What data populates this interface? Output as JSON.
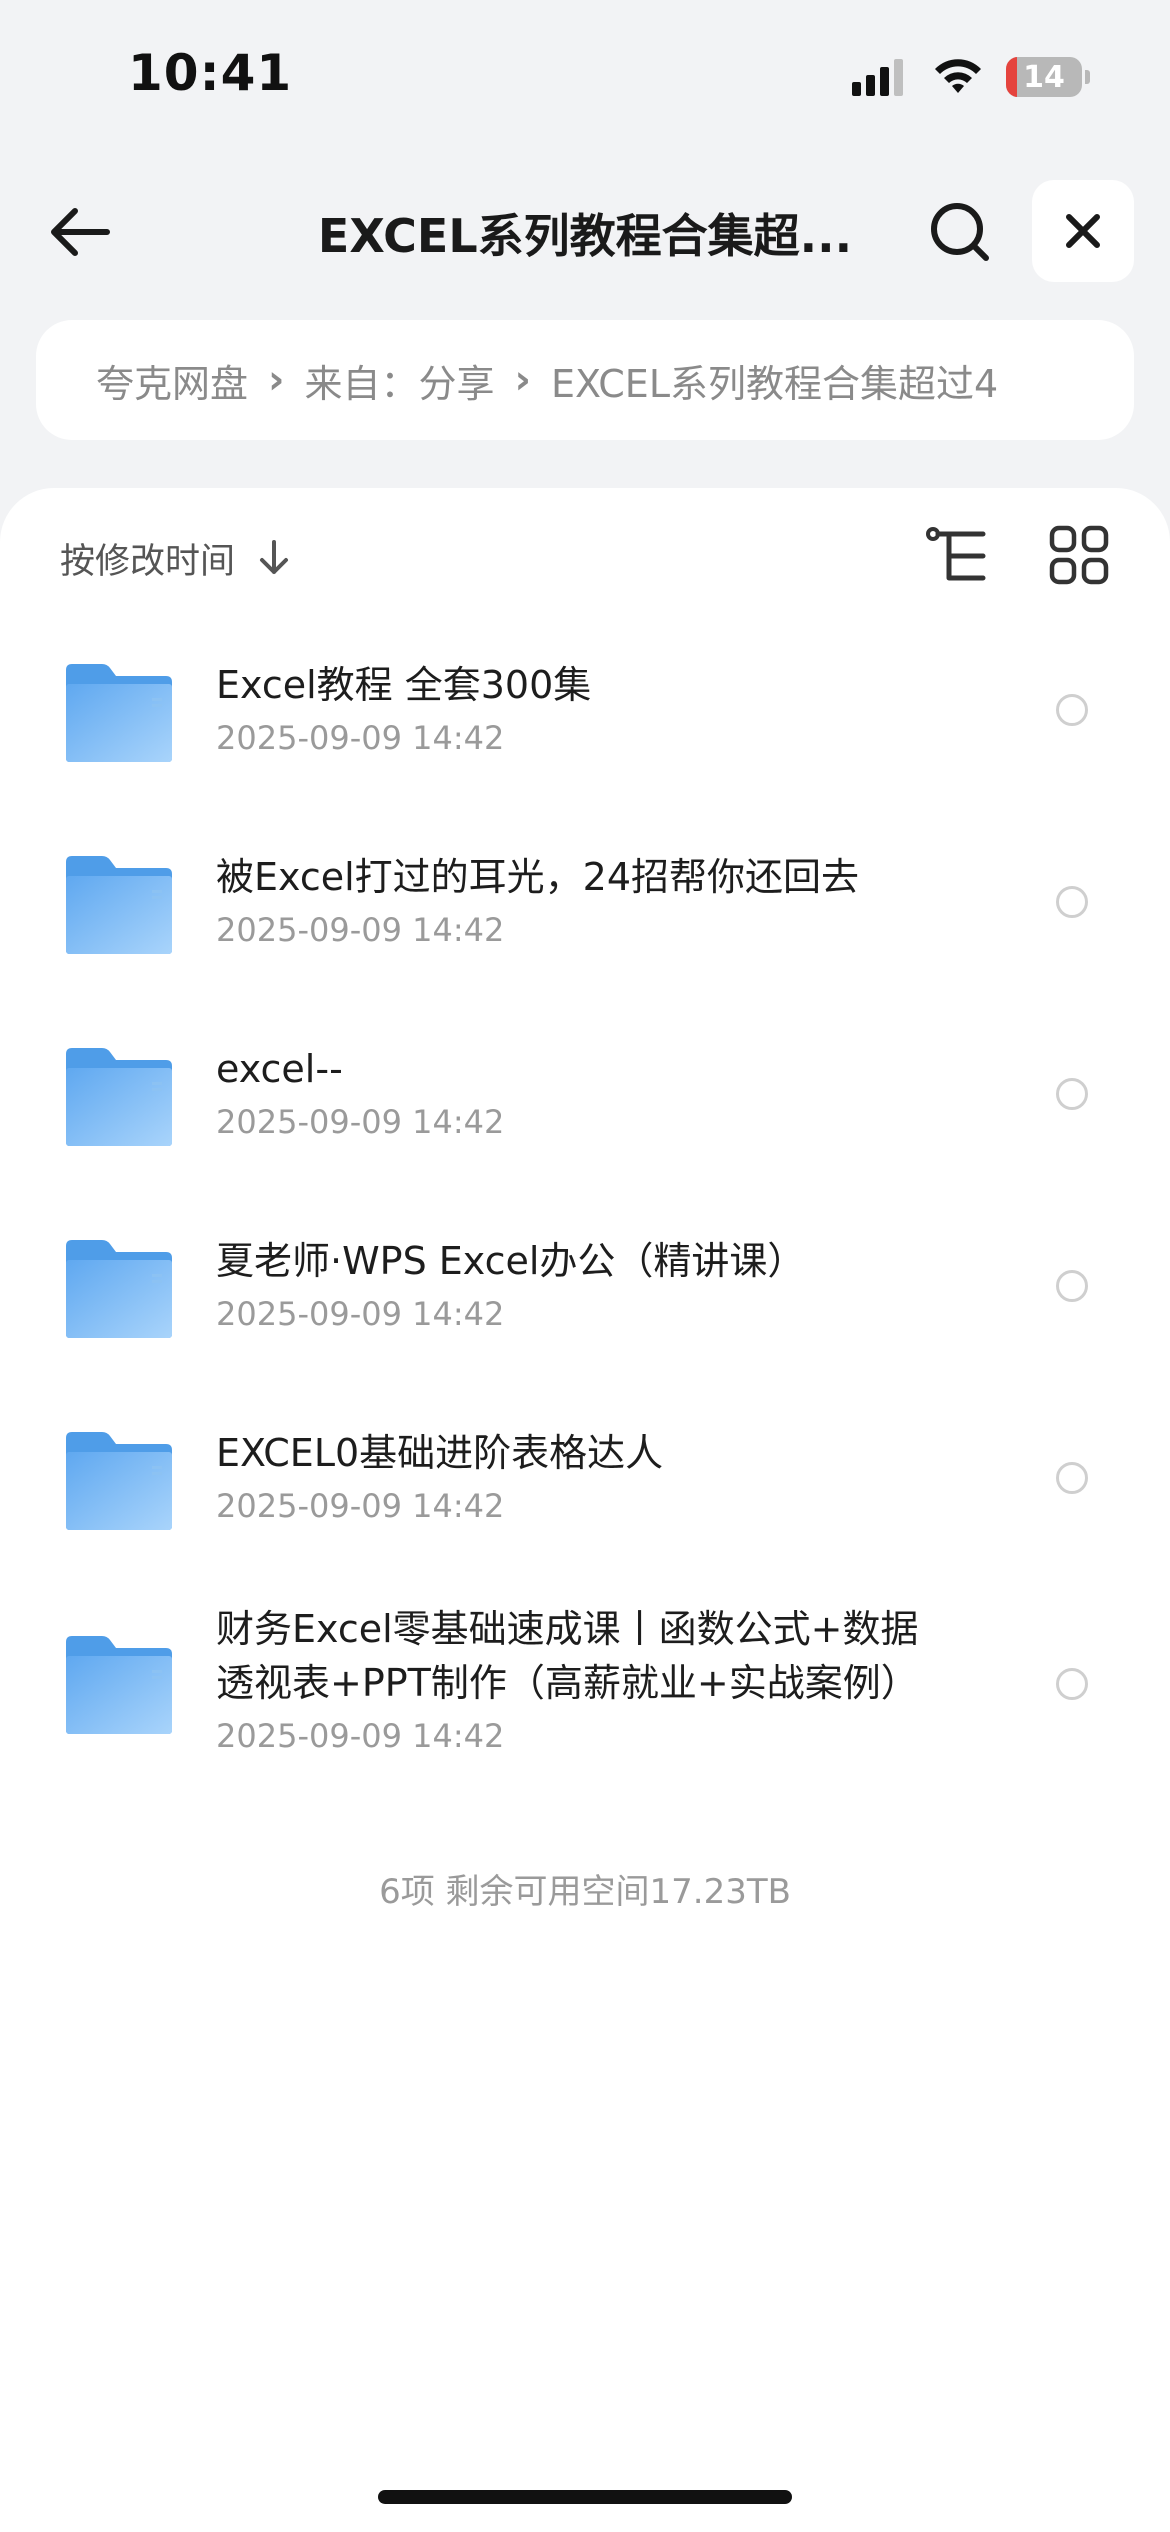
{
  "status_bar": {
    "time": "10:41",
    "battery_level": "14",
    "battery_fraction": 0.14,
    "signal_bars": 3,
    "signal_max": 4,
    "icons": [
      "signal-icon",
      "wifi-icon",
      "battery-icon"
    ]
  },
  "header": {
    "title": "EXCEL系列教程合集超...",
    "back_icon": "arrow-left-icon",
    "search_icon": "search-icon",
    "close_icon": "close-icon"
  },
  "breadcrumb": {
    "items": [
      "夸克网盘",
      "来自：分享",
      "EXCEL系列教程合集超过4"
    ],
    "separator": "›"
  },
  "toolbar": {
    "sort_label": "按修改时间",
    "sort_icon": "arrow-down-icon",
    "tree_icon": "tree-view-icon",
    "grid_icon": "grid-view-icon"
  },
  "files": [
    {
      "name": "Excel教程 全套300集",
      "date": "2025-09-09 14:42"
    },
    {
      "name": "被Excel打过的耳光，24招帮你还回去",
      "date": "2025-09-09 14:42"
    },
    {
      "name": "excel--",
      "date": "2025-09-09 14:42"
    },
    {
      "name": "夏老师·WPS Excel办公（精讲课）",
      "date": "2025-09-09 14:42"
    },
    {
      "name": "EXCEL0基础进阶表格达人",
      "date": "2025-09-09 14:42"
    },
    {
      "name": "财务Excel零基础速成课丨函数公式+数据透视表+PPT制作（高薪就业+实战案例）",
      "date": "2025-09-09 14:42"
    }
  ],
  "footer": {
    "summary": "6项 剩余可用空间17.23TB"
  },
  "colors": {
    "background": "#f2f3f5",
    "folder": "#7ab8f5",
    "battery_low": "#e5433d"
  }
}
